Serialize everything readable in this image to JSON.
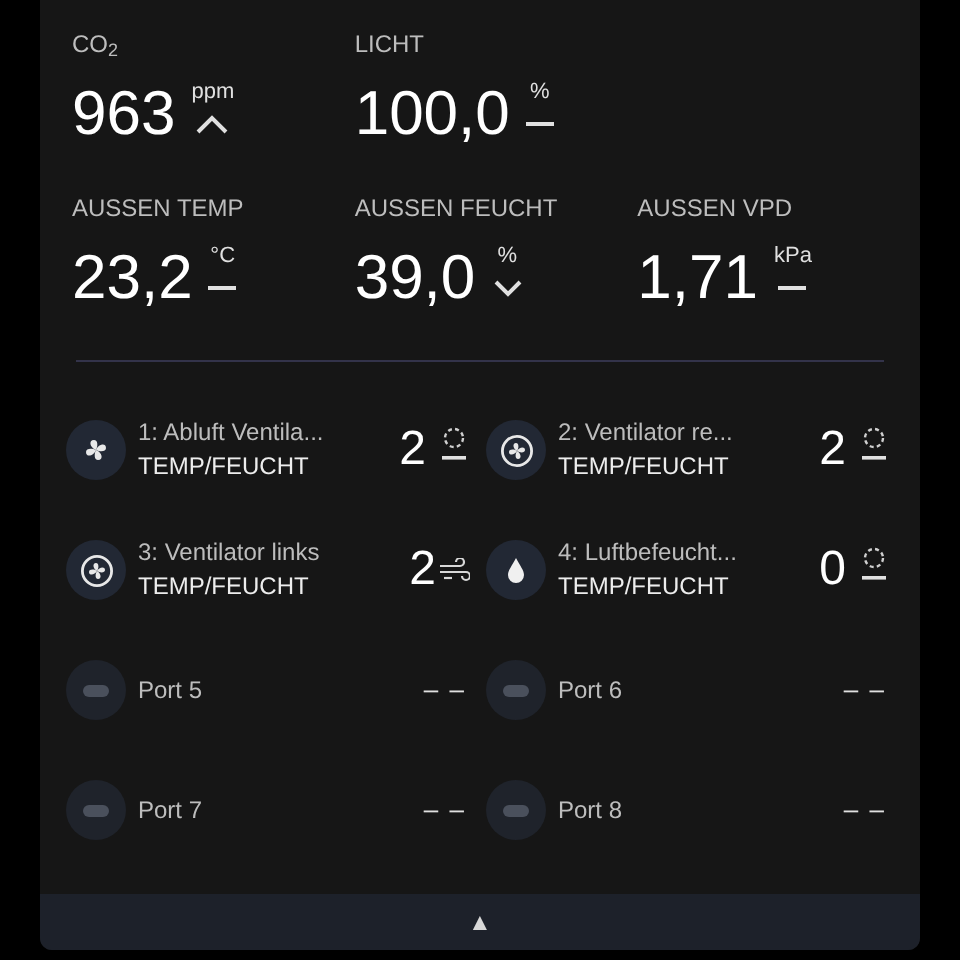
{
  "metrics": [
    {
      "kind": "up",
      "label": "CO$_{2}$",
      "value": "963",
      "unit": "ppm"
    },
    {
      "kind": "flat",
      "label": "LICHT",
      "value": "100,0",
      "unit": "%"
    },
    {
      "kind": "flat",
      "label": "AUSSEN TEMP",
      "value": "23,2",
      "unit": "°C"
    },
    {
      "kind": "down",
      "label": "AUSSEN FEUCHT",
      "value": "39,0",
      "unit": "%"
    },
    {
      "kind": "flat",
      "label": "AUSSEN VPD",
      "value": "1,71",
      "unit": "kPa"
    }
  ],
  "devices": [
    {
      "kind": "fan",
      "name": "1: Abluft Ventila...",
      "mode": "TEMP/FEUCHT",
      "value": "2",
      "airflow": false
    },
    {
      "kind": "fan-ring",
      "name": "2: Ventilator re...",
      "mode": "TEMP/FEUCHT",
      "value": "2",
      "airflow": false
    },
    {
      "kind": "fan-ring",
      "name": "3: Ventilator links",
      "mode": "TEMP/FEUCHT",
      "value": "2",
      "airflow": true
    },
    {
      "kind": "humidifier",
      "name": "4: Luftbefeucht...",
      "mode": "TEMP/FEUCHT",
      "value": "0",
      "airflow": false
    },
    {
      "kind": "port",
      "name": "Port 5",
      "value": "– –"
    },
    {
      "kind": "port",
      "name": "Port 6",
      "value": "– –"
    },
    {
      "kind": "port",
      "name": "Port 7",
      "value": "– –"
    },
    {
      "kind": "port",
      "name": "Port 8",
      "value": "– –"
    }
  ],
  "footer": {
    "button": "▲"
  }
}
